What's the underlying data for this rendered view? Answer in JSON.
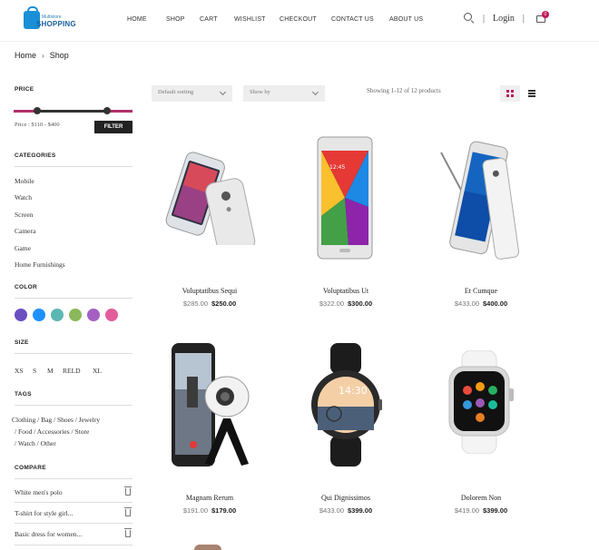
{
  "brand": {
    "line1": "Multistore",
    "line2": "SHOPPING",
    "color": "#1a8fd6"
  },
  "nav": [
    "HOME",
    "SHOP",
    "CART",
    "WISHLIST",
    "CHECKOUT",
    "CONTACT US",
    "ABOUT US"
  ],
  "header": {
    "login": "Login",
    "separator": "|",
    "cart_count": "0",
    "accent": "#c2185b"
  },
  "breadcrumb": {
    "home": "Home",
    "current": "Shop"
  },
  "sidebar": {
    "price_title": "PRICE",
    "price_range_label": "Price : $110 - $400",
    "price_range": {
      "min_value": 110,
      "max_value": 400
    },
    "filter_label": "FILTER",
    "categories_title": "CATEGORIES",
    "categories": [
      "Mobile",
      "Watch",
      "Screen",
      "Camera",
      "Game",
      "Home Furnishings"
    ],
    "color_title": "COLOR",
    "colors": [
      "#6a4fc1",
      "#1e90ff",
      "#5bb8b4",
      "#8bb85a",
      "#a55fc2",
      "#e25d9b"
    ],
    "size_title": "SIZE",
    "sizes": [
      "XS",
      "S",
      "M",
      "RELD",
      "XL"
    ],
    "tags_title": "TAGS",
    "tags_line1": "Clothing  /  Bag  /  Shoes  /  Jewelry",
    "tags_line2": "/  Food  /  Accessories  /  Store",
    "tags_line3": "/  Watch  /  Other",
    "compare_title": "COMPARE",
    "compare": [
      "White men's polo",
      "T-shirt for style girl...",
      "Basic dress for women..."
    ]
  },
  "toolbar": {
    "sort": "Default sorting",
    "show": "Show by",
    "showing": "Showing 1-12 of 12 products"
  },
  "products": [
    {
      "name": "Voluptatibus Sequi",
      "old_price": "$285.00",
      "price": "$250.00",
      "image": "phone-moto"
    },
    {
      "name": "Voluptatibus Ut",
      "old_price": "$322.00",
      "price": "$300.00",
      "image": "tablet-samsung"
    },
    {
      "name": "Et Cumque",
      "old_price": "$433.00",
      "price": "$400.00",
      "image": "phone-note-edge"
    },
    {
      "name": "Magnam Rerum",
      "old_price": "$191.00",
      "price": "$179.00",
      "image": "360-camera"
    },
    {
      "name": "Qui Dignissimos",
      "old_price": "$433.00",
      "price": "$399.00",
      "image": "smartwatch-round"
    },
    {
      "name": "Dolorem Non",
      "old_price": "$419.00",
      "price": "$399.00",
      "image": "apple-watch"
    }
  ]
}
